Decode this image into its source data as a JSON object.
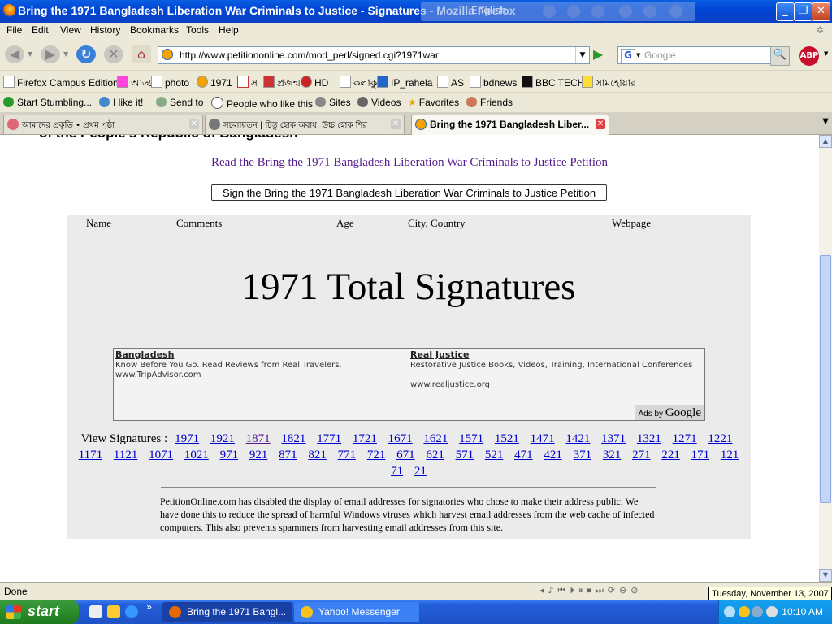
{
  "window": {
    "title": "Bring the 1971 Bangladesh Liberation War Criminals to Justice - Signatures - Mozilla Firefox",
    "overlay_lang": "English"
  },
  "menu": [
    "File",
    "Edit",
    "View",
    "History",
    "Bookmarks",
    "Tools",
    "Help"
  ],
  "nav": {
    "url": "http://www.petitiononline.com/mod_perl/signed.cgi?1971war",
    "search_placeholder": "Google",
    "abp_label": "ABP"
  },
  "bookmarks": [
    "Firefox Campus Edition",
    "আড্ডা",
    "photo",
    "1971",
    "স",
    "প্রজন্ম",
    "HD",
    "কলাকুল",
    "IP_rahela",
    "AS",
    "bdnews",
    "BBC TECH",
    "সামহোয়ার"
  ],
  "stumble": [
    "Start Stumbling...",
    "I like it!",
    "Send to",
    "People who like this",
    "Sites",
    "Videos",
    "Favorites",
    "Friends"
  ],
  "tabs": [
    {
      "label": "আমাদের প্রকৃতি • প্রথম পৃষ্ঠা",
      "active": false
    },
    {
      "label": "সচলায়তন | চিন্তু হোক অবাধ, উচ্চ হোক শির",
      "active": false
    },
    {
      "label": "Bring the 1971 Bangladesh Liber...",
      "active": true
    }
  ],
  "page": {
    "heading_cut": "of the People's Republic of Bangladesh",
    "read_link": "Read the Bring the 1971 Bangladesh Liberation War Criminals to Justice Petition",
    "sign_button": "Sign the Bring the 1971 Bangladesh Liberation War Criminals to Justice  Petition",
    "columns": [
      "Name",
      "Comments",
      "Age",
      "City, Country",
      "Webpage"
    ],
    "total": "1971 Total Signatures",
    "ads": [
      {
        "title": "Bangladesh",
        "desc": "Know Before You Go. Read Reviews from Real Travelers.",
        "url": "www.TripAdvisor.com"
      },
      {
        "title": "Real Justice",
        "desc": "Restorative Justice Books, Videos, Training, International Conferences",
        "url": "www.realjustice.org"
      }
    ],
    "ads_by": "Ads by",
    "ads_brand": "Google",
    "view_label": "View Signatures :",
    "pages": [
      "1971",
      "1921",
      "1871",
      "1821",
      "1771",
      "1721",
      "1671",
      "1621",
      "1571",
      "1521",
      "1471",
      "1421",
      "1371",
      "1321",
      "1271",
      "1221",
      "1171",
      "1121",
      "1071",
      "1021",
      "971",
      "921",
      "871",
      "821",
      "771",
      "721",
      "671",
      "621",
      "571",
      "521",
      "471",
      "421",
      "371",
      "321",
      "271",
      "221",
      "171",
      "121",
      "71",
      "21"
    ],
    "visited_pages": [
      "1871"
    ],
    "notice": "PetitionOnline.com has disabled the display of email addresses for signatories who chose to make their address public. We have done this to reduce the spread of harmful Windows viruses which harvest email addresses from the web cache of infected computers. This also prevents spammers from harvesting email addresses from this site."
  },
  "status": {
    "text": "Done",
    "date_tooltip": "Tuesday, November 13, 2007"
  },
  "taskbar": {
    "start": "start",
    "tasks": [
      "Bring the 1971 Bangl...",
      "Yahoo! Messenger"
    ],
    "clock": "10:10 AM"
  },
  "colors": {
    "link": "#0000cc",
    "visited": "#551a8b",
    "xp_blue": "#245edb",
    "start_green": "#2f8f2f"
  }
}
